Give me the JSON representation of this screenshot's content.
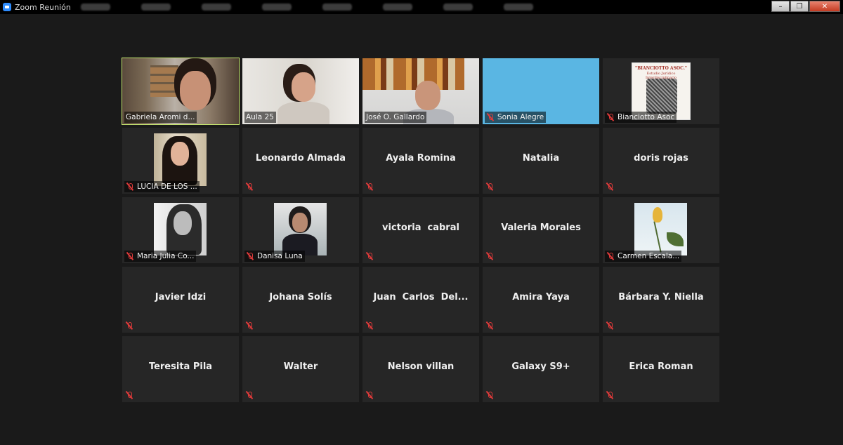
{
  "window": {
    "title": "Zoom Reunión",
    "close_glyph": "✕",
    "restore_glyph": "❐",
    "minimize_glyph": "–"
  },
  "colors": {
    "active_speaker": "#c6e86f",
    "muted": "#e03a3a",
    "tile_bg": "#262626",
    "stage_bg": "#1a1a1a"
  },
  "participants": [
    {
      "name": "Gabriela Aromi d...",
      "kind": "video",
      "active": true,
      "muted": false
    },
    {
      "name": "Aula 25",
      "kind": "video",
      "muted": false
    },
    {
      "name": "José O. Gallardo",
      "kind": "video",
      "muted": false
    },
    {
      "name": "Sonia Alegre",
      "kind": "video",
      "muted": true
    },
    {
      "name": "Bianciotto Asoc",
      "kind": "picture",
      "muted": true,
      "picture_text": "\"BIANCIOTTO ASOC.\"",
      "picture_subtext": "Estudio Jurídico Interdisciplinario"
    },
    {
      "name": "LUCIA DE LOS ...",
      "kind": "picture",
      "muted": true
    },
    {
      "name": "Leonardo Almada",
      "kind": "name",
      "muted": true
    },
    {
      "name": "Ayala Romina",
      "kind": "name",
      "muted": true
    },
    {
      "name": "Natalia",
      "kind": "name",
      "muted": true
    },
    {
      "name": "doris rojas",
      "kind": "name",
      "muted": true
    },
    {
      "name": "Maria Julia Co...",
      "kind": "picture",
      "muted": true
    },
    {
      "name": "Danisa Luna",
      "kind": "picture",
      "muted": true
    },
    {
      "name": "victoria  cabral",
      "kind": "name",
      "muted": true
    },
    {
      "name": "Valeria Morales",
      "kind": "name",
      "muted": true
    },
    {
      "name": "Carmen Escala...",
      "kind": "picture",
      "muted": true
    },
    {
      "name": "Javier Idzi",
      "kind": "name",
      "muted": true
    },
    {
      "name": "Johana Solís",
      "kind": "name",
      "muted": true
    },
    {
      "name": "Juan  Carlos  Del...",
      "kind": "name",
      "muted": true
    },
    {
      "name": "Amira Yaya",
      "kind": "name",
      "muted": true
    },
    {
      "name": "Bárbara Y. Niella",
      "kind": "name",
      "muted": true
    },
    {
      "name": "Teresita Pila",
      "kind": "name",
      "muted": true
    },
    {
      "name": "Walter",
      "kind": "name",
      "muted": true
    },
    {
      "name": "Nelson villan",
      "kind": "name",
      "muted": true
    },
    {
      "name": "Galaxy S9+",
      "kind": "name",
      "muted": true
    },
    {
      "name": "Erica Roman",
      "kind": "name",
      "muted": true
    }
  ]
}
